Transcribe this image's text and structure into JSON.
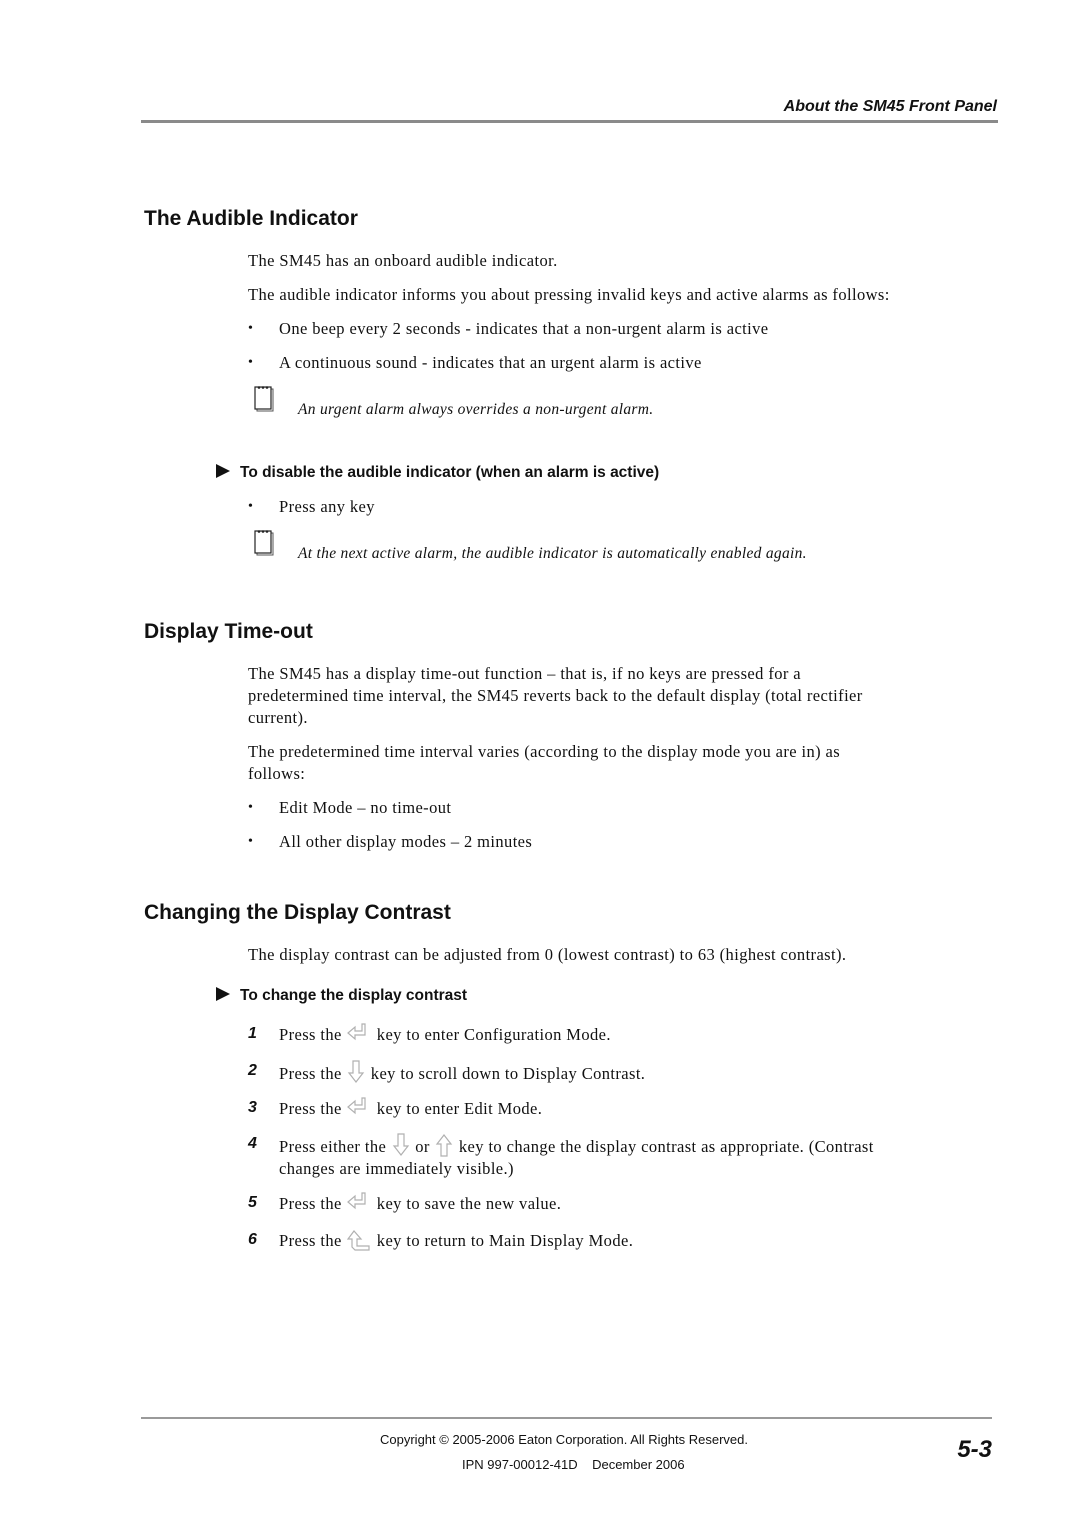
{
  "header": {
    "running_title": "About the SM45 Front Panel"
  },
  "section_audible": {
    "title": "The Audible Indicator",
    "para1": "The SM45 has an onboard audible indicator.",
    "para2": "The audible indicator informs you about pressing invalid keys and active alarms as follows:",
    "bullets": [
      "One beep every 2 seconds - indicates that a non-urgent alarm is active",
      "A continuous sound - indicates that an urgent alarm is active"
    ],
    "note1": "An urgent alarm always overrides a non-urgent alarm.",
    "procedure_title": "To disable the audible indicator (when an alarm is active)",
    "procedure_bullets": [
      "Press any key"
    ],
    "note2": "At the next active alarm, the audible indicator is automatically enabled again."
  },
  "section_timeout": {
    "title": "Display Time-out",
    "para1_lines": [
      "The SM45 has a display time-out function – that is, if no keys are pressed for a",
      "predetermined time interval, the SM45 reverts back to the default display (total rectifier",
      "current)."
    ],
    "para2_lines": [
      "The predetermined time interval varies (according to the display mode you are in) as",
      "follows:"
    ],
    "bullets": [
      "Edit Mode – no time-out",
      "All other display modes – 2 minutes"
    ]
  },
  "section_contrast": {
    "title": "Changing the Display Contrast",
    "para1": "The display contrast can be adjusted from 0 (lowest contrast) to 63 (highest contrast).",
    "procedure_title": "To change the display contrast",
    "steps": [
      {
        "num": "1",
        "pre": "Press the",
        "key": "enter-key",
        "post": "key to enter Configuration Mode."
      },
      {
        "num": "2",
        "pre": "Press the",
        "key": "down-arrow-key",
        "post": "key to scroll down to Display Contrast."
      },
      {
        "num": "3",
        "pre": "Press the",
        "key": "enter-key",
        "post": "key to enter Edit Mode."
      },
      {
        "num": "4",
        "pre": "Press either the",
        "key": "down-arrow-key",
        "mid": "or",
        "key2": "up-arrow-key",
        "post": "key to change the display contrast as appropriate.  (Contrast",
        "line2": "changes are immediately visible.)"
      },
      {
        "num": "5",
        "pre": "Press the",
        "key": "enter-key",
        "post": "key to save the new value."
      },
      {
        "num": "6",
        "pre": "Press the",
        "key": "escape-key",
        "post": "key to return to Main Display Mode."
      }
    ]
  },
  "footer": {
    "copyright": "Copyright © 2005-2006 Eaton Corporation.  All Rights Reserved.",
    "ipn": "IPN 997-00012-41D    December 2006",
    "page_number": "5-3"
  },
  "colors": {
    "rule": "#8a8a8a",
    "key_outline": "#b0b0b0",
    "text": "#111111"
  }
}
